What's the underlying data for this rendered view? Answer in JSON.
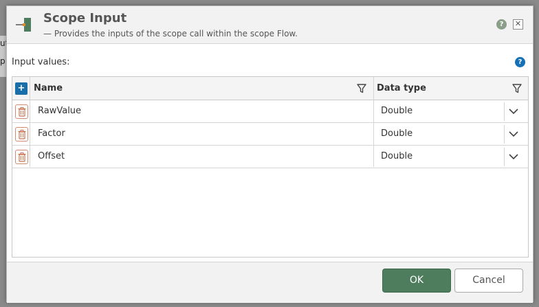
{
  "background": {
    "fragment_top": "ut",
    "fragment_bottom": "p"
  },
  "dialog": {
    "title": "Scope Input",
    "subtitle": "— Provides the inputs of the scope call within the scope Flow.",
    "help_icon": "help-icon",
    "close_icon": "close-icon"
  },
  "section": {
    "label": "Input values:",
    "help_icon": "help-icon"
  },
  "grid": {
    "add_label": "+",
    "columns": {
      "name": "Name",
      "type": "Data type"
    },
    "rows": [
      {
        "name": "RawValue",
        "type": "Double"
      },
      {
        "name": "Factor",
        "type": "Double"
      },
      {
        "name": "Offset",
        "type": "Double"
      }
    ]
  },
  "footer": {
    "ok_label": "OK",
    "cancel_label": "Cancel"
  },
  "colors": {
    "accent": "#1a6fa8",
    "ok_button": "#4e7d5e",
    "delete_border": "#d28a70"
  }
}
